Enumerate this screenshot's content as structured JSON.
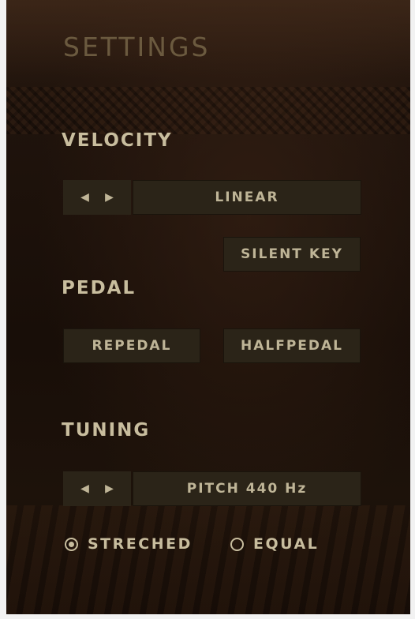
{
  "title": "SETTINGS",
  "velocity": {
    "label": "VELOCITY",
    "prev_icon": "◀",
    "next_icon": "▶",
    "value": "LINEAR",
    "silent_key": "SILENT KEY"
  },
  "pedal": {
    "label": "PEDAL",
    "repedal": "REPEDAL",
    "halfpedal": "HALFPEDAL"
  },
  "tuning": {
    "label": "TUNING",
    "prev_icon": "◀",
    "next_icon": "▶",
    "value": "PITCH 440 Hz",
    "options": [
      "STRECHED",
      "EQUAL"
    ],
    "selected": "STRECHED"
  },
  "colors": {
    "text": "#c8bd9e",
    "title": "#6b5a3f",
    "button_bg": "#2b2418"
  }
}
